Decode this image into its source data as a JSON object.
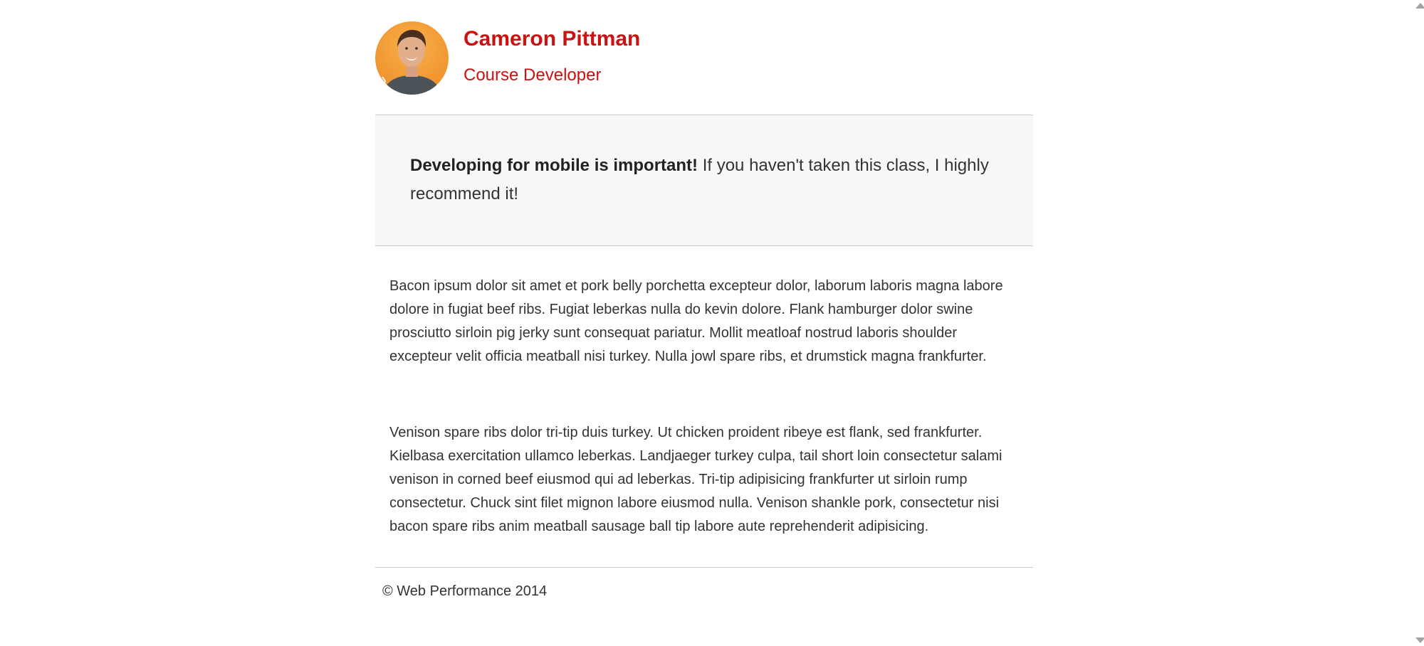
{
  "author": {
    "name": "Cameron Pittman",
    "role": "Course Developer"
  },
  "callout": {
    "bold": "Developing for mobile is important!",
    "text": " If you haven't taken this class, I highly recommend it!"
  },
  "paragraphs": [
    "Bacon ipsum dolor sit amet et pork belly porchetta excepteur dolor, laborum laboris magna labore dolore in fugiat beef ribs. Fugiat leberkas nulla do kevin dolore. Flank hamburger dolor swine prosciutto sirloin pig jerky sunt consequat pariatur. Mollit meatloaf nostrud laboris shoulder excepteur velit officia meatball nisi turkey. Nulla jowl spare ribs, et drumstick magna frankfurter.",
    "Venison spare ribs dolor tri-tip duis turkey. Ut chicken proident ribeye est flank, sed frankfurter. Kielbasa exercitation ullamco leberkas. Landjaeger turkey culpa, tail short loin consectetur salami venison in corned beef eiusmod qui ad leberkas. Tri-tip adipisicing frankfurter ut sirloin rump consectetur. Chuck sint filet mignon labore eiusmod nulla. Venison shankle pork, consectetur nisi bacon spare ribs anim meatball sausage ball tip labore aute reprehenderit adipisicing."
  ],
  "footer": {
    "text": "© Web Performance 2014"
  },
  "colors": {
    "accent": "#cc1111",
    "callout_bg": "#f7f7f7",
    "rule": "#c8c8c8",
    "text": "#333333"
  },
  "icons": {
    "scroll_up": "triangle-up-icon",
    "scroll_down": "triangle-down-icon"
  }
}
